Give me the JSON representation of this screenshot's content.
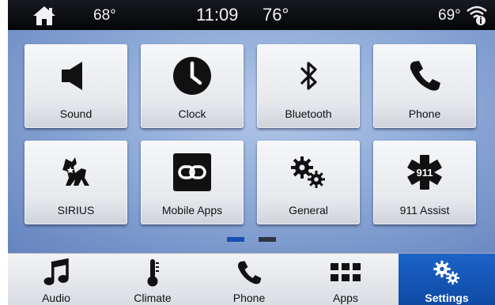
{
  "status": {
    "left_temp": "68°",
    "time": "11:09",
    "outside_temp": "76°",
    "right_temp": "69°"
  },
  "tiles": [
    {
      "label": "Sound",
      "icon": "speaker-icon"
    },
    {
      "label": "Clock",
      "icon": "clock-icon"
    },
    {
      "label": "Bluetooth",
      "icon": "bluetooth-icon"
    },
    {
      "label": "Phone",
      "icon": "phone-icon"
    },
    {
      "label": "SIRIUS",
      "icon": "sirius-dog-icon"
    },
    {
      "label": "Mobile Apps",
      "icon": "link-icon"
    },
    {
      "label": "General",
      "icon": "gears-icon"
    },
    {
      "label": "911 Assist",
      "icon": "star-of-life-911-icon",
      "badge": "911"
    }
  ],
  "page_indicator": {
    "count": 2,
    "active": 1
  },
  "nav": [
    {
      "label": "Audio",
      "icon": "music-note-icon"
    },
    {
      "label": "Climate",
      "icon": "thermometer-icon"
    },
    {
      "label": "Phone",
      "icon": "phone-icon"
    },
    {
      "label": "Apps",
      "icon": "apps-grid-icon"
    },
    {
      "label": "Settings",
      "icon": "gears-icon",
      "active": true
    }
  ],
  "colors": {
    "accent": "#1d63c9",
    "indicator_active": "#1a4fb0",
    "indicator_inactive": "#2b3545"
  }
}
